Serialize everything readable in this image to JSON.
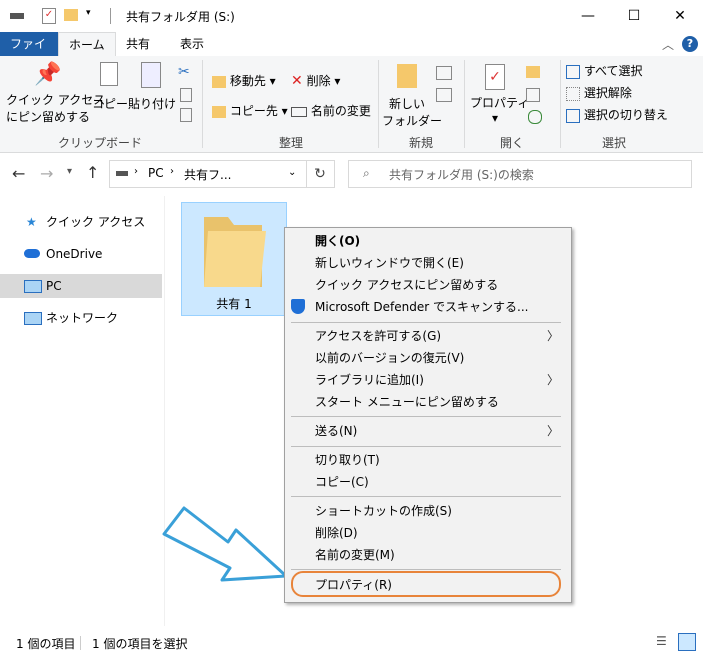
{
  "title": "共有フォルダ用 (S:)",
  "tabs": [
    "ファイル",
    "ホーム",
    "共有",
    "表示"
  ],
  "ribbon": {
    "clipboard": {
      "pin": "クイック アクセス\nにピン留めする",
      "pin1": "クイック アクセス",
      "pin2": "にピン留めする",
      "copy": "コピー",
      "paste": "貼り付け",
      "label": "クリップボード"
    },
    "organize": {
      "move": "移動先",
      "copyto": "コピー先",
      "delete": "削除",
      "rename": "名前の変更",
      "label": "整理"
    },
    "new": {
      "folder1": "新しい",
      "folder2": "フォルダー",
      "label": "新規"
    },
    "open": {
      "properties": "プロパティ",
      "label": "開く"
    },
    "select": {
      "all": "すべて選択",
      "none": "選択解除",
      "invert": "選択の切り替え",
      "label": "選択"
    }
  },
  "address": {
    "pc": "PC",
    "folder": "共有フ...",
    "search_placeholder": "共有フォルダ用 (S:)の検索"
  },
  "nav": [
    "クイック アクセス",
    "OneDrive",
    "PC",
    "ネットワーク"
  ],
  "folder_name": "共有 1",
  "menu": [
    {
      "label": "開く(O)",
      "bold": true
    },
    {
      "label": "新しいウィンドウで開く(E)"
    },
    {
      "label": "クイック アクセスにピン留めする"
    },
    {
      "label": "Microsoft Defender でスキャンする..."
    },
    {
      "label": "アクセスを許可する(G)",
      "sub": true
    },
    {
      "label": "以前のバージョンの復元(V)"
    },
    {
      "label": "ライブラリに追加(I)",
      "sub": true
    },
    {
      "label": "スタート メニューにピン留めする"
    },
    {
      "label": "送る(N)",
      "sub": true
    },
    {
      "label": "切り取り(T)"
    },
    {
      "label": "コピー(C)"
    },
    {
      "label": "ショートカットの作成(S)"
    },
    {
      "label": "削除(D)"
    },
    {
      "label": "名前の変更(M)"
    },
    {
      "label": "プロパティ(R)"
    }
  ],
  "status": {
    "count": "1 個の項目",
    "selected": "1 個の項目を選択"
  },
  "colors": {
    "accent": "#1f5fa8",
    "selection": "#cce8ff",
    "highlight_ring": "#e8843a",
    "arrow": "#3aa0d8"
  }
}
